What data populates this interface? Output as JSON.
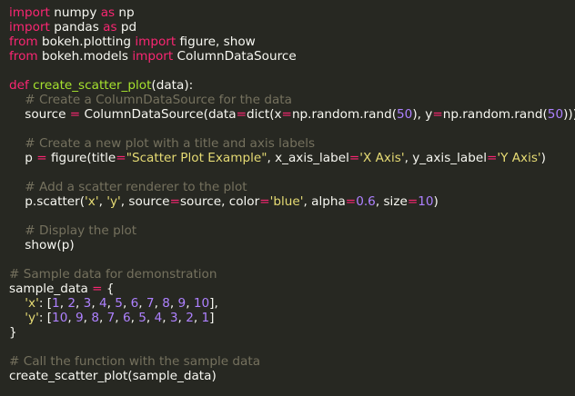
{
  "colors": {
    "background": "#272822",
    "text": "#f8f8f2",
    "keyword": "#f92672",
    "function": "#a6e22e",
    "string": "#e6db74",
    "number": "#ae81ff",
    "comment": "#75715e"
  },
  "code_lines": [
    [
      [
        "kw",
        "import"
      ],
      [
        "pl",
        " numpy "
      ],
      [
        "kw",
        "as"
      ],
      [
        "pl",
        " np"
      ]
    ],
    [
      [
        "kw",
        "import"
      ],
      [
        "pl",
        " pandas "
      ],
      [
        "kw",
        "as"
      ],
      [
        "pl",
        " pd"
      ]
    ],
    [
      [
        "kw",
        "from"
      ],
      [
        "pl",
        " bokeh.plotting "
      ],
      [
        "kw",
        "import"
      ],
      [
        "pl",
        " figure, show"
      ]
    ],
    [
      [
        "kw",
        "from"
      ],
      [
        "pl",
        " bokeh.models "
      ],
      [
        "kw",
        "import"
      ],
      [
        "pl",
        " ColumnDataSource"
      ]
    ],
    [],
    [
      [
        "kw",
        "def"
      ],
      [
        "pl",
        " "
      ],
      [
        "fn",
        "create_scatter_plot"
      ],
      [
        "pl",
        "(data):"
      ]
    ],
    [
      [
        "pl",
        "    "
      ],
      [
        "cm",
        "# Create a ColumnDataSource for the data"
      ]
    ],
    [
      [
        "pl",
        "    source "
      ],
      [
        "op",
        "="
      ],
      [
        "pl",
        " ColumnDataSource(data"
      ],
      [
        "op",
        "="
      ],
      [
        "pl",
        "dict(x"
      ],
      [
        "op",
        "="
      ],
      [
        "pl",
        "np.random.rand("
      ],
      [
        "num",
        "50"
      ],
      [
        "pl",
        "), y"
      ],
      [
        "op",
        "="
      ],
      [
        "pl",
        "np.random.rand("
      ],
      [
        "num",
        "50"
      ],
      [
        "pl",
        ")))"
      ]
    ],
    [],
    [
      [
        "pl",
        "    "
      ],
      [
        "cm",
        "# Create a new plot with a title and axis labels"
      ]
    ],
    [
      [
        "pl",
        "    p "
      ],
      [
        "op",
        "="
      ],
      [
        "pl",
        " figure(title"
      ],
      [
        "op",
        "="
      ],
      [
        "str",
        "\"Scatter Plot Example\""
      ],
      [
        "pl",
        ", x_axis_label"
      ],
      [
        "op",
        "="
      ],
      [
        "str",
        "'X Axis'"
      ],
      [
        "pl",
        ", y_axis_label"
      ],
      [
        "op",
        "="
      ],
      [
        "str",
        "'Y Axis'"
      ],
      [
        "pl",
        ")"
      ]
    ],
    [],
    [
      [
        "pl",
        "    "
      ],
      [
        "cm",
        "# Add a scatter renderer to the plot"
      ]
    ],
    [
      [
        "pl",
        "    p.scatter("
      ],
      [
        "str",
        "'x'"
      ],
      [
        "pl",
        ", "
      ],
      [
        "str",
        "'y'"
      ],
      [
        "pl",
        ", source"
      ],
      [
        "op",
        "="
      ],
      [
        "pl",
        "source, color"
      ],
      [
        "op",
        "="
      ],
      [
        "str",
        "'blue'"
      ],
      [
        "pl",
        ", alpha"
      ],
      [
        "op",
        "="
      ],
      [
        "num",
        "0.6"
      ],
      [
        "pl",
        ", size"
      ],
      [
        "op",
        "="
      ],
      [
        "num",
        "10"
      ],
      [
        "pl",
        ")"
      ]
    ],
    [],
    [
      [
        "pl",
        "    "
      ],
      [
        "cm",
        "# Display the plot"
      ]
    ],
    [
      [
        "pl",
        "    show(p)"
      ]
    ],
    [],
    [
      [
        "cm",
        "# Sample data for demonstration"
      ]
    ],
    [
      [
        "pl",
        "sample_data "
      ],
      [
        "op",
        "="
      ],
      [
        "pl",
        " {"
      ]
    ],
    [
      [
        "pl",
        "    "
      ],
      [
        "str",
        "'x'"
      ],
      [
        "pl",
        ": ["
      ],
      [
        "num",
        "1"
      ],
      [
        "pl",
        ", "
      ],
      [
        "num",
        "2"
      ],
      [
        "pl",
        ", "
      ],
      [
        "num",
        "3"
      ],
      [
        "pl",
        ", "
      ],
      [
        "num",
        "4"
      ],
      [
        "pl",
        ", "
      ],
      [
        "num",
        "5"
      ],
      [
        "pl",
        ", "
      ],
      [
        "num",
        "6"
      ],
      [
        "pl",
        ", "
      ],
      [
        "num",
        "7"
      ],
      [
        "pl",
        ", "
      ],
      [
        "num",
        "8"
      ],
      [
        "pl",
        ", "
      ],
      [
        "num",
        "9"
      ],
      [
        "pl",
        ", "
      ],
      [
        "num",
        "10"
      ],
      [
        "pl",
        "],"
      ]
    ],
    [
      [
        "pl",
        "    "
      ],
      [
        "str",
        "'y'"
      ],
      [
        "pl",
        ": ["
      ],
      [
        "num",
        "10"
      ],
      [
        "pl",
        ", "
      ],
      [
        "num",
        "9"
      ],
      [
        "pl",
        ", "
      ],
      [
        "num",
        "8"
      ],
      [
        "pl",
        ", "
      ],
      [
        "num",
        "7"
      ],
      [
        "pl",
        ", "
      ],
      [
        "num",
        "6"
      ],
      [
        "pl",
        ", "
      ],
      [
        "num",
        "5"
      ],
      [
        "pl",
        ", "
      ],
      [
        "num",
        "4"
      ],
      [
        "pl",
        ", "
      ],
      [
        "num",
        "3"
      ],
      [
        "pl",
        ", "
      ],
      [
        "num",
        "2"
      ],
      [
        "pl",
        ", "
      ],
      [
        "num",
        "1"
      ],
      [
        "pl",
        "]"
      ]
    ],
    [
      [
        "pl",
        "}"
      ]
    ],
    [],
    [
      [
        "cm",
        "# Call the function with the sample data"
      ]
    ],
    [
      [
        "pl",
        "create_scatter_plot(sample_data)"
      ]
    ]
  ]
}
